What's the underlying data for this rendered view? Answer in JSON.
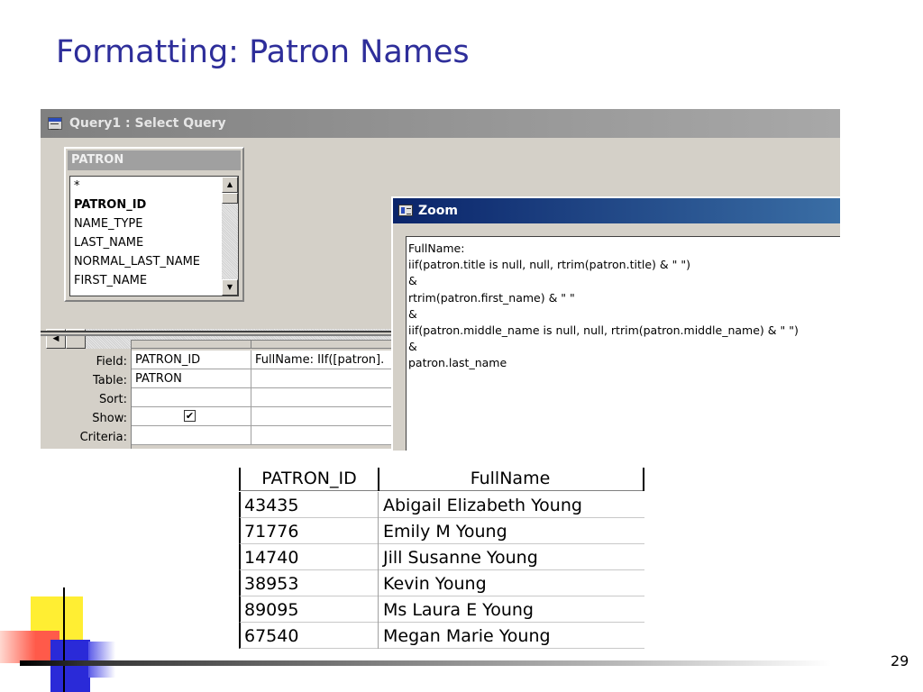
{
  "slide": {
    "title": "Formatting: Patron Names",
    "page_number": "29"
  },
  "query_window": {
    "title": "Query1 : Select Query",
    "field_list": {
      "title": "PATRON",
      "items": [
        "*",
        "PATRON_ID",
        "NAME_TYPE",
        "LAST_NAME",
        "NORMAL_LAST_NAME",
        "FIRST_NAME"
      ]
    },
    "grid": {
      "row_labels": [
        "Field:",
        "Table:",
        "Sort:",
        "Show:",
        "Criteria:"
      ],
      "columns": [
        {
          "field": "PATRON_ID",
          "table": "PATRON",
          "show": true
        },
        {
          "field": "FullName: IIf([patron].",
          "table": "",
          "show": false
        }
      ]
    }
  },
  "zoom_dialog": {
    "title": "Zoom",
    "lines": [
      "FullName:",
      "iif(patron.title is null, null, rtrim(patron.title) & \" \")",
      "&",
      "rtrim(patron.first_name) & \" \"",
      "&",
      "iif(patron.middle_name is null, null, rtrim(patron.middle_name) & \" \")",
      "&",
      "patron.last_name"
    ]
  },
  "results": {
    "headers": [
      "PATRON_ID",
      "FullName"
    ],
    "rows": [
      [
        "43435",
        "Abigail Elizabeth Young"
      ],
      [
        "71776",
        "Emily M Young"
      ],
      [
        "14740",
        "Jill Susanne Young"
      ],
      [
        "38953",
        "Kevin Young"
      ],
      [
        "89095",
        "Ms Laura E Young"
      ],
      [
        "67540",
        "Megan Marie Young"
      ]
    ]
  },
  "colors": {
    "title": "#2e2e9a",
    "zoom_titlebar": "#0a246a",
    "deco_yellow": "#ffee33",
    "deco_red": "#ff5a4a",
    "deco_blue": "#2a2ad8"
  }
}
